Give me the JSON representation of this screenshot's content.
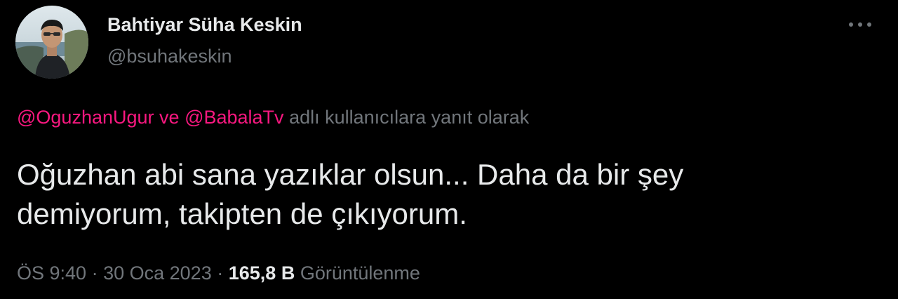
{
  "author": {
    "name": "Bahtiyar Süha Keskin",
    "handle": "@bsuhakeskin"
  },
  "reply_context": {
    "mention_1": "@OguzhanUgur",
    "conjunction": "ve",
    "mention_2": "@BabalaTv",
    "suffix": "adlı kullanıcılara yanıt olarak"
  },
  "tweet": {
    "line_1": "Oğuzhan abi sana yazıklar olsun... Daha da bir şey",
    "line_2": "demiyorum, takipten de çıkıyorum."
  },
  "meta": {
    "time": "ÖS 9:40",
    "separator": "·",
    "date": "30 Oca 2023",
    "views_count": "165,8 B",
    "views_label": "Görüntülenme"
  },
  "icons": {
    "more": "more-horizontal-icon"
  },
  "colors": {
    "background": "#000000",
    "text_primary": "#e7e9ea",
    "text_secondary": "#71767b",
    "mention": "#f91880"
  }
}
